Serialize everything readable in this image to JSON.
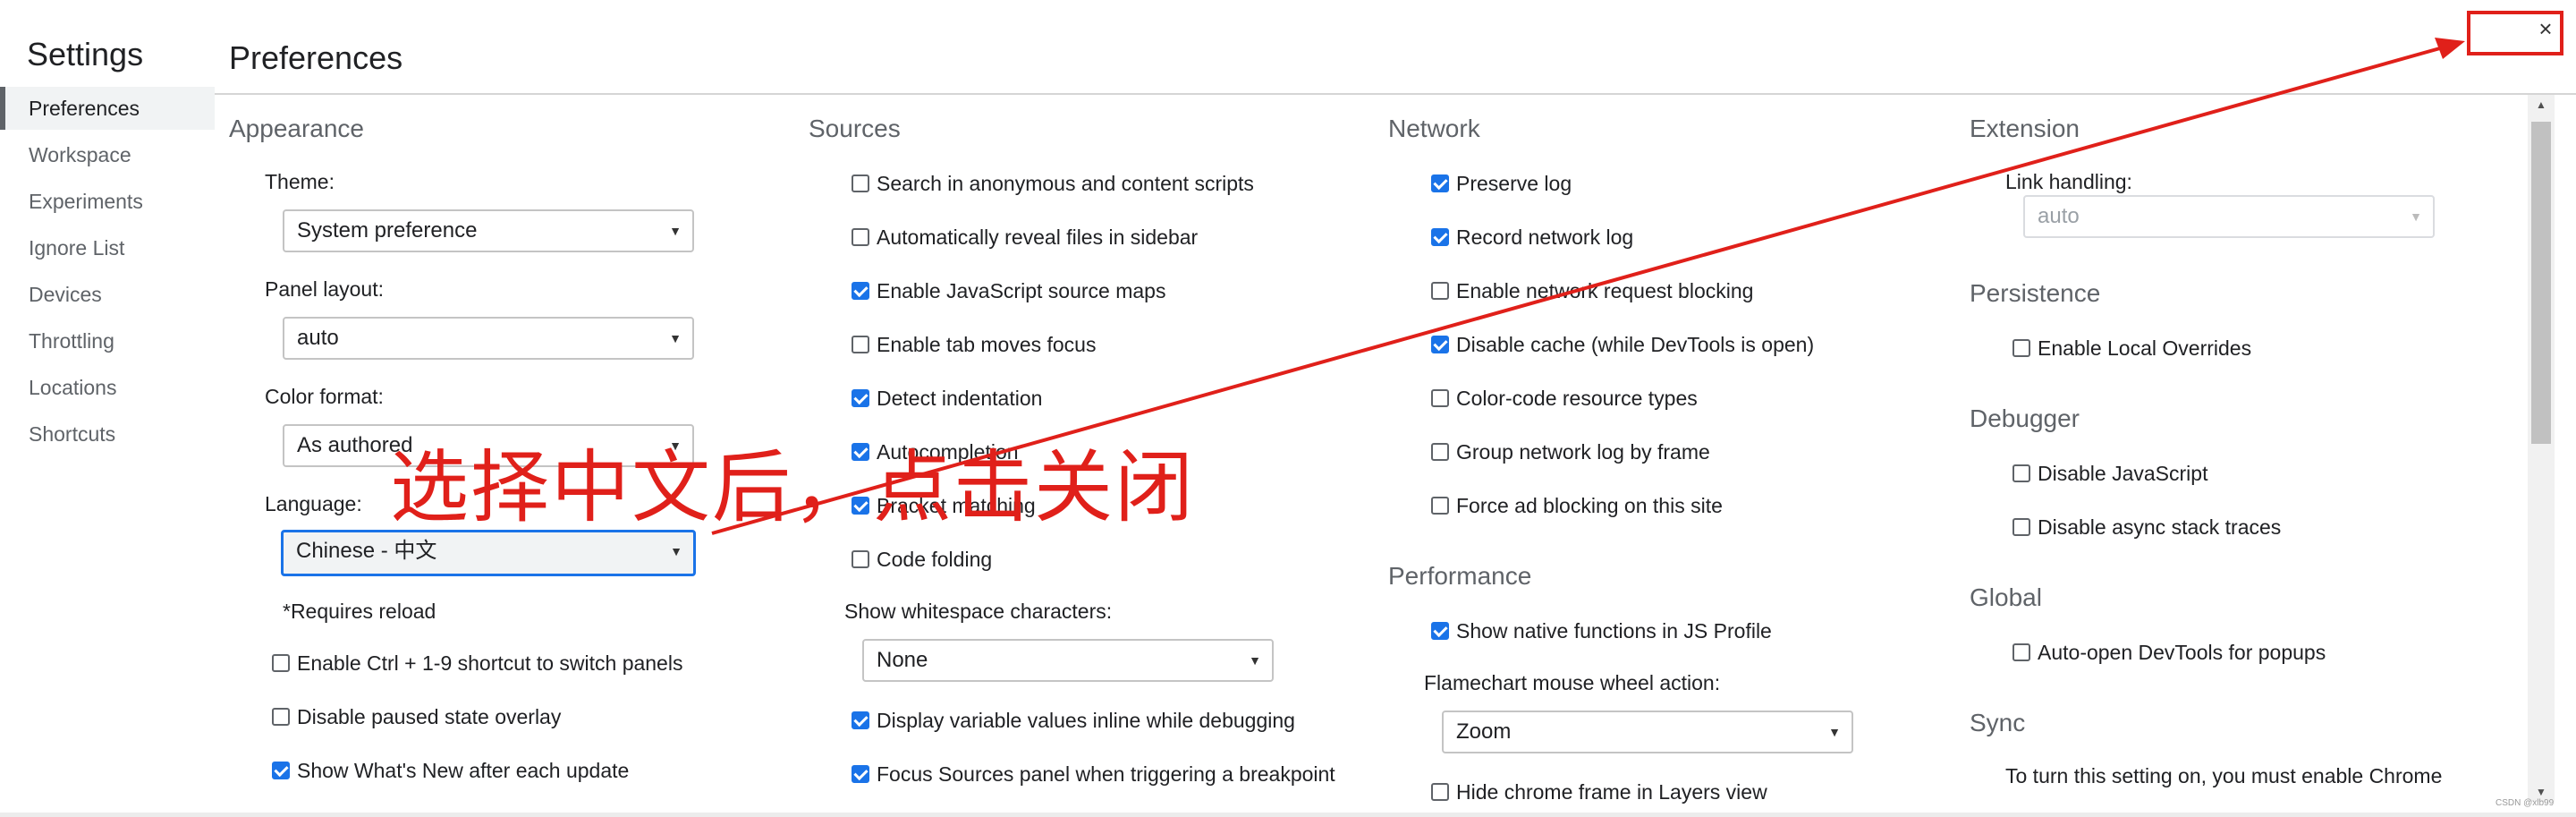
{
  "sidebar": {
    "title": "Settings",
    "items": [
      {
        "label": "Preferences",
        "active": true
      },
      {
        "label": "Workspace"
      },
      {
        "label": "Experiments"
      },
      {
        "label": "Ignore List"
      },
      {
        "label": "Devices"
      },
      {
        "label": "Throttling"
      },
      {
        "label": "Locations"
      },
      {
        "label": "Shortcuts"
      }
    ]
  },
  "header": {
    "title": "Preferences",
    "close_icon": "×"
  },
  "appearance": {
    "title": "Appearance",
    "theme_label": "Theme:",
    "theme_value": "System preference",
    "panel_layout_label": "Panel layout:",
    "panel_layout_value": "auto",
    "color_format_label": "Color format:",
    "color_format_value": "As authored",
    "language_label": "Language:",
    "language_value": "Chinese - 中文",
    "requires_reload": "*Requires reload",
    "options": [
      {
        "label": "Enable Ctrl + 1-9 shortcut to switch panels",
        "checked": false
      },
      {
        "label": "Disable paused state overlay",
        "checked": false
      },
      {
        "label": "Show What's New after each update",
        "checked": true
      }
    ]
  },
  "sources": {
    "title": "Sources",
    "options": [
      {
        "label": "Search in anonymous and content scripts",
        "checked": false
      },
      {
        "label": "Automatically reveal files in sidebar",
        "checked": false
      },
      {
        "label": "Enable JavaScript source maps",
        "checked": true
      },
      {
        "label": "Enable tab moves focus",
        "checked": false
      },
      {
        "label": "Detect indentation",
        "checked": true
      },
      {
        "label": "Autocompletion",
        "checked": true
      },
      {
        "label": "Bracket matching",
        "checked": true
      },
      {
        "label": "Code folding",
        "checked": false
      }
    ],
    "whitespace_label": "Show whitespace characters:",
    "whitespace_value": "None",
    "options2": [
      {
        "label": "Display variable values inline while debugging",
        "checked": true
      },
      {
        "label": "Focus Sources panel when triggering a breakpoint",
        "checked": true
      }
    ]
  },
  "network": {
    "title": "Network",
    "options": [
      {
        "label": "Preserve log",
        "checked": true
      },
      {
        "label": "Record network log",
        "checked": true
      },
      {
        "label": "Enable network request blocking",
        "checked": false
      },
      {
        "label": "Disable cache (while DevTools is open)",
        "checked": true
      },
      {
        "label": "Color-code resource types",
        "checked": false
      },
      {
        "label": "Group network log by frame",
        "checked": false
      },
      {
        "label": "Force ad blocking on this site",
        "checked": false
      }
    ]
  },
  "performance": {
    "title": "Performance",
    "show_native": {
      "label": "Show native functions in JS Profile",
      "checked": true
    },
    "flamechart_label": "Flamechart mouse wheel action:",
    "flamechart_value": "Zoom",
    "hide_chrome": {
      "label": "Hide chrome frame in Layers view",
      "checked": false
    }
  },
  "extension": {
    "title": "Extension",
    "link_label": "Link handling:",
    "link_value": "auto"
  },
  "persistence": {
    "title": "Persistence",
    "option": {
      "label": "Enable Local Overrides",
      "checked": false
    }
  },
  "debugger": {
    "title": "Debugger",
    "options": [
      {
        "label": "Disable JavaScript",
        "checked": false
      },
      {
        "label": "Disable async stack traces",
        "checked": false
      }
    ]
  },
  "global": {
    "title": "Global",
    "option": {
      "label": "Auto-open DevTools for popups",
      "checked": false
    }
  },
  "sync": {
    "title": "Sync",
    "text": "To turn this setting on, you must enable Chrome"
  },
  "annotation": {
    "text": "选择中文后，点击关闭",
    "color": "#e0201a"
  },
  "watermark": "CSDN @xlb99",
  "colors": {
    "accent": "#1a73e8",
    "annotation_red": "#e0201a"
  }
}
